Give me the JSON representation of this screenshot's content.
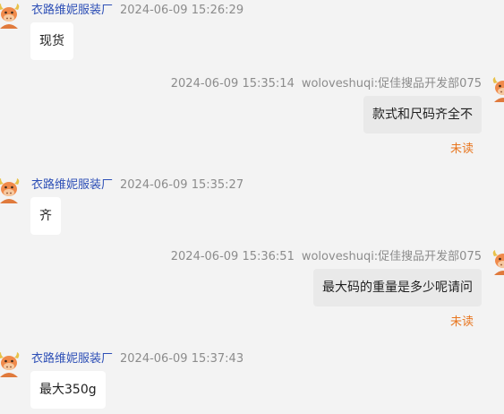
{
  "messages": [
    {
      "direction": "in",
      "sender": "衣路维妮服装厂",
      "time": "2024-06-09 15:26:29",
      "text": "现货"
    },
    {
      "direction": "out",
      "sender": "woloveshuqi:促佳搜品开发部075",
      "time": "2024-06-09 15:35:14",
      "text": "款式和尺码齐全不",
      "status": "未读"
    },
    {
      "direction": "in",
      "sender": "衣路维妮服装厂",
      "time": "2024-06-09 15:35:27",
      "text": "齐"
    },
    {
      "direction": "out",
      "sender": "woloveshuqi:促佳搜品开发部075",
      "time": "2024-06-09 15:36:51",
      "text": "最大码的重量是多少呢请问",
      "status": "未读"
    },
    {
      "direction": "in",
      "sender": "衣路维妮服装厂",
      "time": "2024-06-09 15:37:43",
      "text": "最大350g"
    }
  ]
}
